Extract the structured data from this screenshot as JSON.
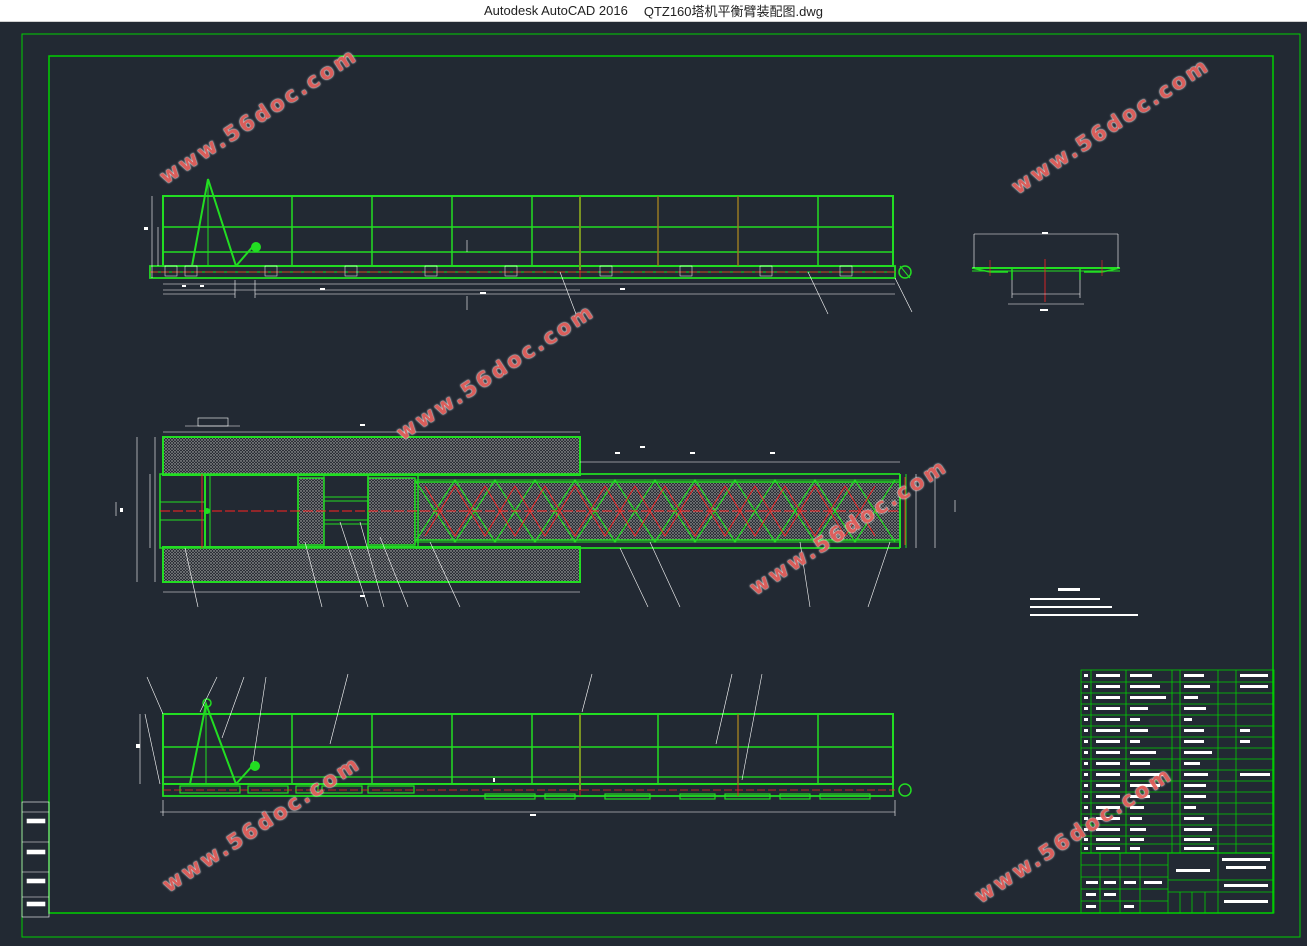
{
  "window": {
    "app_name": "Autodesk AutoCAD 2016",
    "file_name": "QTZ160塔机平衡臂装配图.dwg"
  },
  "drawing": {
    "watermark_text": "www.56doc.com",
    "colors": {
      "background": "#222933",
      "frame": "#00d000",
      "structure": "#22dd22",
      "centerline": "#ff2222",
      "dimension": "#ffffff",
      "hatch": "#bfbfbf",
      "watermark": "#e4615e"
    },
    "views": [
      "front-elevation",
      "end-section",
      "plan-view",
      "bottom-elevation"
    ]
  }
}
